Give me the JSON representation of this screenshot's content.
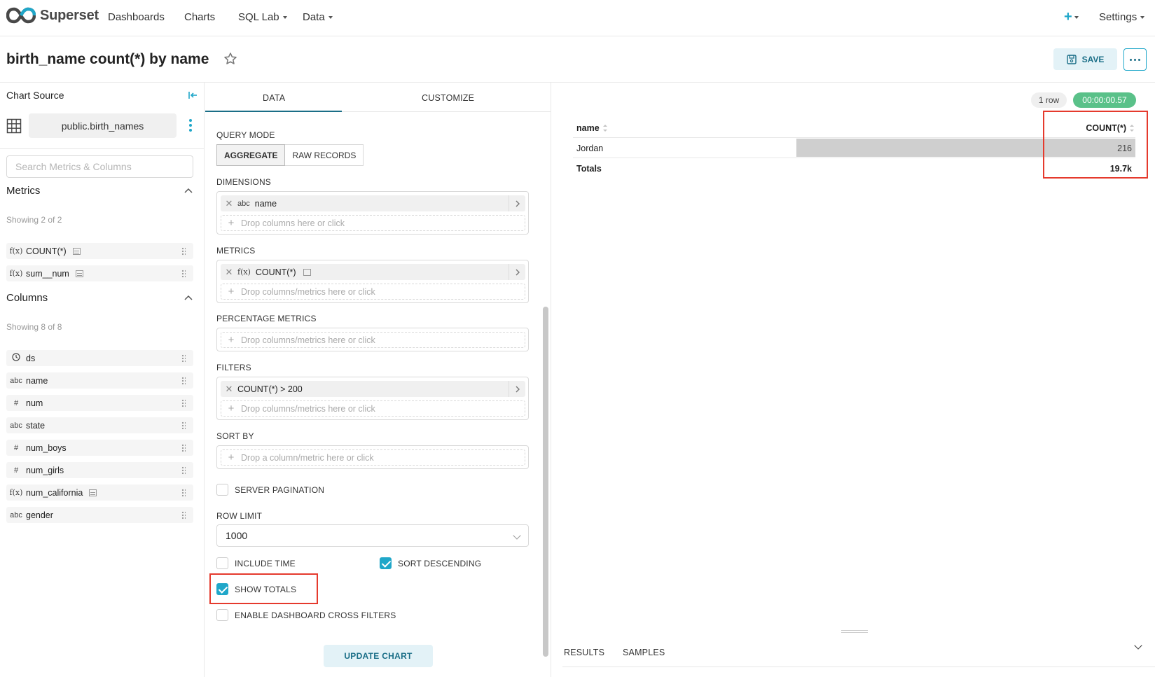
{
  "nav": {
    "brand": "Superset",
    "items": [
      {
        "label": "Dashboards",
        "dropdown": false
      },
      {
        "label": "Charts",
        "dropdown": false
      },
      {
        "label": "SQL Lab",
        "dropdown": true
      },
      {
        "label": "Data",
        "dropdown": true
      }
    ],
    "plus": "+",
    "settings": "Settings"
  },
  "header": {
    "title": "birth_name count(*) by name",
    "save_label": "SAVE"
  },
  "datasource": {
    "heading": "Chart Source",
    "name": "public.birth_names",
    "search_placeholder": "Search Metrics & Columns"
  },
  "metrics": {
    "heading": "Metrics",
    "showing": "Showing 2 of 2",
    "items": [
      {
        "icon": "f(x)",
        "label": "COUNT(*)"
      },
      {
        "icon": "f(x)",
        "label": "sum__num"
      }
    ]
  },
  "columns": {
    "heading": "Columns",
    "showing": "Showing 8 of 8",
    "items": [
      {
        "icon": "clock",
        "label": "ds"
      },
      {
        "icon": "abc",
        "label": "name"
      },
      {
        "icon": "#",
        "label": "num"
      },
      {
        "icon": "abc",
        "label": "state"
      },
      {
        "icon": "#",
        "label": "num_boys"
      },
      {
        "icon": "#",
        "label": "num_girls"
      },
      {
        "icon": "f(x)",
        "label": "num_california"
      },
      {
        "icon": "abc",
        "label": "gender"
      }
    ]
  },
  "panel": {
    "tabs": [
      "DATA",
      "CUSTOMIZE"
    ],
    "query_mode_label": "QUERY MODE",
    "query_modes": [
      "AGGREGATE",
      "RAW RECORDS"
    ],
    "dimensions_label": "DIMENSIONS",
    "dimension_item": "name",
    "dimension_icon": "abc",
    "metrics_label": "METRICS",
    "metric_item": "COUNT(*)",
    "metric_icon": "f(x)",
    "percentage_label": "PERCENTAGE METRICS",
    "filters_label": "FILTERS",
    "filter_item": "COUNT(*) > 200",
    "sortby_label": "SORT BY",
    "drop_columns": "Drop columns here or click",
    "drop_columns_metrics": "Drop columns/metrics here or click",
    "drop_column_metric": "Drop a column/metric here or click",
    "server_pagination": "SERVER PAGINATION",
    "row_limit_label": "ROW LIMIT",
    "row_limit_value": "1000",
    "include_time": "INCLUDE TIME",
    "sort_descending": "SORT DESCENDING",
    "show_totals": "SHOW TOTALS",
    "cross_filters": "ENABLE DASHBOARD CROSS FILTERS",
    "update_label": "UPDATE CHART"
  },
  "result": {
    "rows_badge": "1 row",
    "time_badge": "00:00:00.57",
    "col_name": "name",
    "col_count": "COUNT(*)",
    "row_name": "Jordan",
    "row_value": "216",
    "totals_label": "Totals",
    "totals_value": "19.7k",
    "bar_fraction": 1.0
  },
  "bottom_tabs": [
    "RESULTS",
    "SAMPLES"
  ],
  "colors": {
    "accent": "#20a7c9",
    "accent_dark": "#1a6e87",
    "success": "#5ac189",
    "highlight": "#e53a2d"
  }
}
